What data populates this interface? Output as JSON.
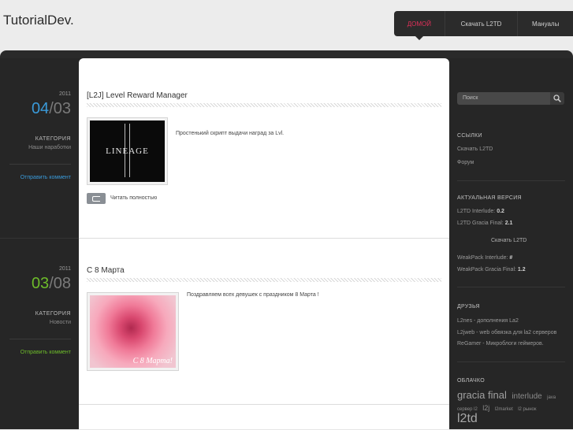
{
  "site": {
    "title": "TutorialDev."
  },
  "nav": [
    {
      "label": "ДОМОЙ",
      "active": true
    },
    {
      "label": "Скачать L2TD",
      "active": false
    },
    {
      "label": "Мануалы",
      "active": false
    }
  ],
  "posts": [
    {
      "year": "2011",
      "day": "04",
      "month": "03",
      "category_label": "КАТЕГОРИЯ",
      "category": "Наши наработки",
      "comment": "Отправить коммент",
      "title": "[L2J] Level Reward Manager",
      "text": "Простенький скрипт выдачи наград за Lvl.",
      "read_more": "Читать полностью",
      "image_caption": "LINEAGE"
    },
    {
      "year": "2011",
      "day": "03",
      "month": "08",
      "category_label": "КАТЕГОРИЯ",
      "category": "Новости",
      "comment": "Отправить коммент",
      "title": "С 8 Марта",
      "text": "Поздравляем всех девушек с праздником 8 Марта !",
      "image_caption": "C 8 Марта!"
    }
  ],
  "sidebar": {
    "search_placeholder": "Поиск",
    "links": {
      "heading": "ССЫЛКИ",
      "items": [
        "Скачать L2TD",
        "Форум"
      ]
    },
    "version": {
      "heading": "АКТУАЛЬНАЯ ВЕРСИЯ",
      "l2td_interlude_label": "L2TD Interlude:",
      "l2td_interlude_val": "0.2",
      "l2td_gracia_label": "L2TD Gracia Final:",
      "l2td_gracia_val": "2.1",
      "download": "Скачать L2TD",
      "weak_interlude_label": "WeakPack Interlude:",
      "weak_interlude_val": "#",
      "weak_gracia_label": "WeakPack Gracia Final:",
      "weak_gracia_val": "1.2"
    },
    "friends": {
      "heading": "ДРУЗЬЯ",
      "items": [
        "L2nes - дополнения La2",
        "L2jweb - web обвязка для la2 серверов",
        "ReGamer - Микроблоги геймеров."
      ]
    },
    "cloud": {
      "heading": "ОБЛАЧКО",
      "tags": [
        "gracia final",
        "interlude",
        "java",
        "сервер l2",
        "l2j",
        "l2market",
        "l2 рынок",
        "l2td"
      ]
    }
  },
  "colors": {
    "accent_blue": "#3a9ad9",
    "accent_green": "#6dbb2a",
    "accent_red": "#e0305a"
  }
}
